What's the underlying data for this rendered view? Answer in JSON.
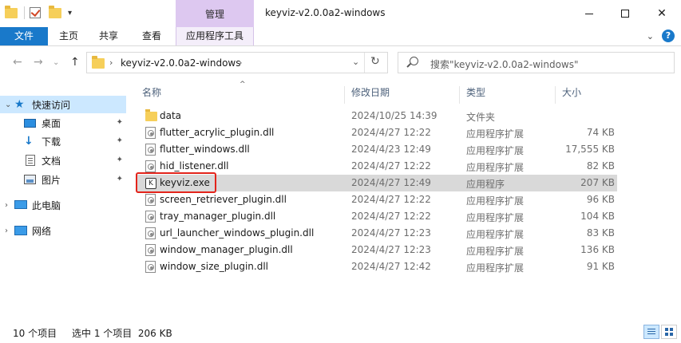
{
  "window": {
    "title": "keyviz-v2.0.0a2-windows",
    "context_tab_header": "管理",
    "minimize": "—",
    "close": "✕"
  },
  "ribbon": {
    "tabs": [
      "文件",
      "主页",
      "共享",
      "查看",
      "应用程序工具"
    ],
    "collapse_glyph": "⌄",
    "help_glyph": "?"
  },
  "nav": {
    "back": "←",
    "forward": "→",
    "recent": "⌄",
    "up": "↑",
    "address_path": "keyviz-v2.0.0a2-windows",
    "refresh": "↻",
    "search_placeholder": "搜索\"keyviz-v2.0.0a2-windows\""
  },
  "navpane": {
    "items": [
      {
        "label": "快速访问",
        "icon": "star-icon",
        "selected": true,
        "expanded": true
      },
      {
        "label": "桌面",
        "icon": "desktop-icon",
        "pinned": true
      },
      {
        "label": "下载",
        "icon": "download-icon",
        "pinned": true
      },
      {
        "label": "文档",
        "icon": "documents-icon",
        "pinned": true
      },
      {
        "label": "图片",
        "icon": "pictures-icon",
        "pinned": true
      },
      {
        "label": "此电脑",
        "icon": "this-pc-icon"
      },
      {
        "label": "网络",
        "icon": "network-icon"
      }
    ]
  },
  "columns": {
    "name": "名称",
    "date": "修改日期",
    "type": "类型",
    "size": "大小"
  },
  "files": [
    {
      "name": "data",
      "date": "2024/10/25 14:39",
      "type": "文件夹",
      "size": "",
      "icon": "folder"
    },
    {
      "name": "flutter_acrylic_plugin.dll",
      "date": "2024/4/27 12:22",
      "type": "应用程序扩展",
      "size": "74 KB",
      "icon": "dll"
    },
    {
      "name": "flutter_windows.dll",
      "date": "2024/4/23 12:49",
      "type": "应用程序扩展",
      "size": "17,555 KB",
      "icon": "dll"
    },
    {
      "name": "hid_listener.dll",
      "date": "2024/4/27 12:22",
      "type": "应用程序扩展",
      "size": "82 KB",
      "icon": "dll"
    },
    {
      "name": "keyviz.exe",
      "date": "2024/4/27 12:49",
      "type": "应用程序",
      "size": "207 KB",
      "icon": "exe",
      "selected": true
    },
    {
      "name": "screen_retriever_plugin.dll",
      "date": "2024/4/27 12:22",
      "type": "应用程序扩展",
      "size": "96 KB",
      "icon": "dll"
    },
    {
      "name": "tray_manager_plugin.dll",
      "date": "2024/4/27 12:22",
      "type": "应用程序扩展",
      "size": "104 KB",
      "icon": "dll"
    },
    {
      "name": "url_launcher_windows_plugin.dll",
      "date": "2024/4/27 12:23",
      "type": "应用程序扩展",
      "size": "83 KB",
      "icon": "dll"
    },
    {
      "name": "window_manager_plugin.dll",
      "date": "2024/4/27 12:23",
      "type": "应用程序扩展",
      "size": "136 KB",
      "icon": "dll"
    },
    {
      "name": "window_size_plugin.dll",
      "date": "2024/4/27 12:42",
      "type": "应用程序扩展",
      "size": "91 KB",
      "icon": "dll"
    }
  ],
  "exe_glyph": "K",
  "pin_glyph": "📌",
  "status": {
    "item_count": "10 个项目",
    "selection": "选中 1 个项目  206 KB"
  },
  "colors": {
    "file_tab": "#1979ca",
    "manage_tab": "#ddc8f0",
    "selection_nav": "#cce8ff",
    "selection_row": "#d9d9d9",
    "highlight": "#e3241b"
  }
}
